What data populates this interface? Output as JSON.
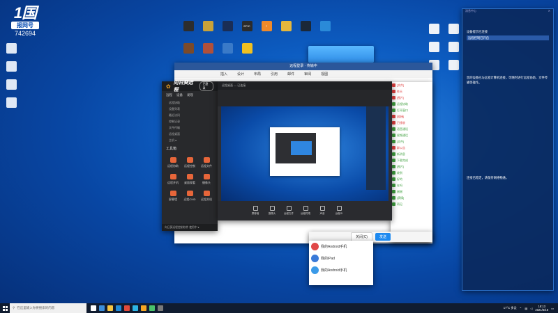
{
  "desktop": {
    "logo_big": "1国",
    "logo_tag": "报网号",
    "logo_num": "742694",
    "icons_left": [
      {
        "label": "",
        "color": "#dfe8f5"
      },
      {
        "label": "",
        "color": "#dfe8f5"
      },
      {
        "label": "",
        "color": "#dfe8f5"
      },
      {
        "label": "",
        "color": "#dfe8f5"
      }
    ],
    "icons_top": [
      {
        "label": "",
        "color": "#2d2d2d"
      },
      {
        "label": "",
        "color": "#c8a23a"
      },
      {
        "label": "",
        "color": "#1a2d55"
      },
      {
        "label": "EPIC",
        "color": "#2b2b2b"
      },
      {
        "label": "?",
        "color": "#f08a2a"
      },
      {
        "label": "",
        "color": "#e6b73c"
      },
      {
        "label": "",
        "color": "#1b2838"
      },
      {
        "label": "",
        "color": "#2a8ad8"
      }
    ],
    "icons_top2": [
      {
        "label": "",
        "color": "#7a4a2a"
      },
      {
        "label": "",
        "color": "#b0503a"
      },
      {
        "label": "",
        "color": "#3a7ac8"
      },
      {
        "label": "",
        "color": "#f0c020"
      }
    ],
    "icons_right": [
      {
        "label": "",
        "color": "#eef2f8"
      },
      {
        "label": "",
        "color": "#eef2f8"
      },
      {
        "label": "",
        "color": "#eef2f8"
      },
      {
        "label": "",
        "color": "#eef2f8"
      },
      {
        "label": "",
        "color": "#eef2f8"
      },
      {
        "label": "",
        "color": "#eef2f8"
      }
    ]
  },
  "text_window": {
    "title": "远程登录 · 传输中",
    "ribbon": [
      "插入",
      "设计",
      "布局",
      "引用",
      "邮件",
      "审阅",
      "视图"
    ]
  },
  "remote_app": {
    "brand": "向日葵远程",
    "pill": "已登录",
    "tabs": [
      "远程",
      "设备",
      "发现"
    ],
    "list": [
      "远程协助",
      "设备列表",
      "最近访问",
      "控制记录",
      "文件传输",
      "远程桌面",
      "主机 ▾"
    ],
    "section": "工具箱",
    "tools": [
      "远程协助",
      "远程控制",
      "远程文件",
      "远程开机",
      "桌面观看",
      "摄像头",
      "屏幕墙",
      "远程CMD",
      "远程关机"
    ],
    "footer": "向日葵远程控制软件 使用中 ▾"
  },
  "viewer": {
    "header": "远程桌面 — 已连接",
    "tools": [
      "屏幕墙",
      "摄像头",
      "远程文件",
      "远程终端",
      "声音",
      "远程ID"
    ]
  },
  "chat": {
    "items": [
      {
        "text": "[文件]",
        "color": "#e04040"
      },
      {
        "text": "昨天",
        "color": "#e04040"
      },
      {
        "text": "[图片]",
        "color": "#e04040"
      },
      {
        "text": "远程协助",
        "color": "#40a040"
      },
      {
        "text": "打开窗口",
        "color": "#40a040"
      },
      {
        "text": "[链接]",
        "color": "#e04040"
      },
      {
        "text": "已接收",
        "color": "#e04040"
      },
      {
        "text": "语音通话",
        "color": "#40a040"
      },
      {
        "text": "视频通话",
        "color": "#40a040"
      },
      {
        "text": "[文件]",
        "color": "#40a040"
      },
      {
        "text": "群公告",
        "color": "#e04040"
      },
      {
        "text": "新消息",
        "color": "#40a040"
      },
      {
        "text": "下载完成",
        "color": "#40a040"
      },
      {
        "text": "[图片]",
        "color": "#40a040"
      },
      {
        "text": "收到",
        "color": "#40a040"
      },
      {
        "text": "好的",
        "color": "#40a040"
      },
      {
        "text": "在吗",
        "color": "#40a040"
      },
      {
        "text": "谢谢",
        "color": "#40a040"
      },
      {
        "text": "[表情]",
        "color": "#40a040"
      },
      {
        "text": "再见",
        "color": "#40a040"
      }
    ],
    "close_btn": "关闭(C)",
    "send_btn": "发送"
  },
  "phone": {
    "rows": [
      {
        "name": "我的Android手机",
        "color": "#e04848"
      },
      {
        "name": "我的iPad",
        "color": "#3a7ad8"
      },
      {
        "name": "我的Android手机",
        "color": "#3a9ae8"
      }
    ]
  },
  "panel": {
    "title": "消息中心",
    "line1": "设备提示已连接",
    "line2": "远程控制已开启",
    "para1": "您的设备已与远程计算机连接，可随时进行远程协助、文件传输等操作。",
    "para2": "连接已稳定，请保持网络畅通。"
  },
  "taskbar": {
    "search_placeholder": "在这里输入你要搜索的内容",
    "weather": "17°C 多云",
    "time": "18:13",
    "date": "2021/6/16"
  }
}
